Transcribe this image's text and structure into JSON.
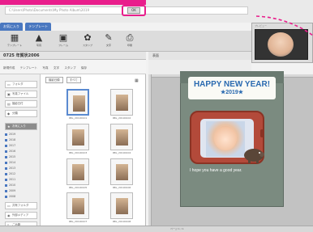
{
  "address_bar": {
    "url": "C:\\Users\\Photo\\Documents\\My Photo Album\\2019"
  },
  "go_button": {
    "label": "OK"
  },
  "app_tabs": [
    "お気に入り",
    "テンプレート"
  ],
  "toolbar": [
    {
      "icon": "template-icon",
      "label": "テンプレート"
    },
    {
      "icon": "photo-icon",
      "label": "写真"
    },
    {
      "icon": "frame-icon",
      "label": "フレーム"
    },
    {
      "icon": "stamp-icon",
      "label": "スタンプ"
    },
    {
      "icon": "text-icon",
      "label": "文字"
    },
    {
      "icon": "print-icon",
      "label": "印刷"
    }
  ],
  "project_title": "0725 年賀状2006",
  "menu_items": [
    "新規作成",
    "テンプレート",
    "写真",
    "文字",
    "スタンプ",
    "保存"
  ],
  "canvas_header": "表面",
  "preview": {
    "title": "プレビュー"
  },
  "sidebar": {
    "items": [
      {
        "icon": "folder-icon",
        "label": "フォルダ"
      },
      {
        "icon": "image-icon",
        "label": "写真ファイル"
      },
      {
        "icon": "calendar-icon",
        "label": "撮影日付"
      },
      {
        "icon": "tag-icon",
        "label": "分類"
      },
      {
        "icon": "star-icon",
        "label": "お気に入り",
        "highlighted": true
      }
    ],
    "sub_items": [
      "2019",
      "2018",
      "2017",
      "2016",
      "2015",
      "2014",
      "2013",
      "2012",
      "2011",
      "2010",
      "2009",
      "2008"
    ],
    "bottom_items": [
      {
        "icon": "folder-icon",
        "label": "共有フォルダ"
      },
      {
        "icon": "disk-icon",
        "label": "外部メディア"
      },
      {
        "icon": "trash-icon",
        "label": "ごみ箱"
      }
    ]
  },
  "grid": {
    "sort_label": "撮影日順",
    "filter_label": "すべて",
    "thumbnails": [
      {
        "caption": "IMG_20190101"
      },
      {
        "caption": "IMG_20190102"
      },
      {
        "caption": "IMG_20190103"
      },
      {
        "caption": "IMG_20190104"
      },
      {
        "caption": "IMG_20190105"
      },
      {
        "caption": "IMG_20190106"
      },
      {
        "caption": "IMG_20190107"
      },
      {
        "caption": "IMG_20190108"
      }
    ]
  },
  "card": {
    "line1": "HAPPY NEW YEAR!",
    "line2": "★2019★",
    "message": "I hope you have a good year."
  },
  "statusbar": "ページ 1 / 1",
  "colors": {
    "highlight": "#e91e8c",
    "title_text": "#2a6ab0",
    "card_background": "#7b8b80",
    "tv_frame": "#b34a3a"
  }
}
